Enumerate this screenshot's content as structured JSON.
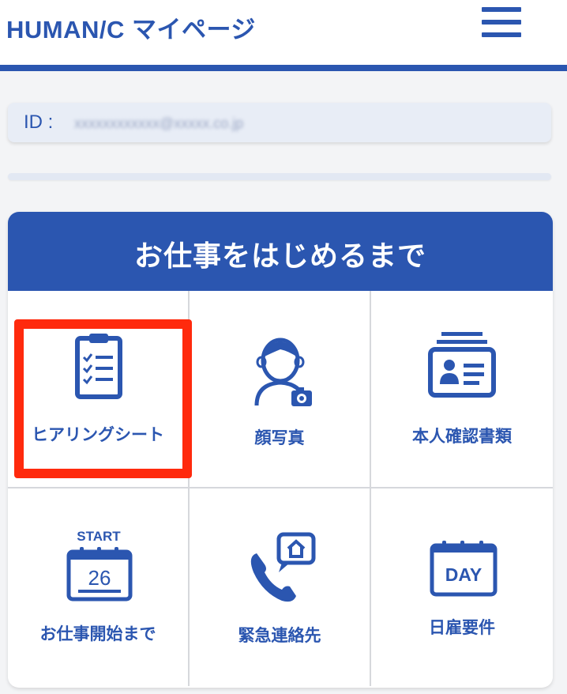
{
  "header": {
    "logo_text": "HUMAN/C マイページ",
    "menu_icon": "hamburger-icon"
  },
  "account": {
    "id_label": "ID :",
    "id_value": "xxxxxxxxxxxx@xxxxx.co.jp"
  },
  "section": {
    "title": "お仕事をはじめるまで",
    "items": [
      {
        "label": "ヒアリングシート",
        "icon": "clipboard-checklist-icon"
      },
      {
        "label": "顔写真",
        "icon": "face-photo-icon"
      },
      {
        "label": "本人確認書類",
        "icon": "id-card-icon"
      },
      {
        "label": "お仕事開始まで",
        "icon": "start-calendar-icon",
        "icon_top_text": "START",
        "icon_day": "26"
      },
      {
        "label": "緊急連絡先",
        "icon": "phone-home-icon"
      },
      {
        "label": "日雇要件",
        "icon": "day-calendar-icon",
        "icon_text": "DAY"
      }
    ]
  },
  "colors": {
    "brand": "#2b56b0",
    "highlight": "#ff2a0d"
  }
}
